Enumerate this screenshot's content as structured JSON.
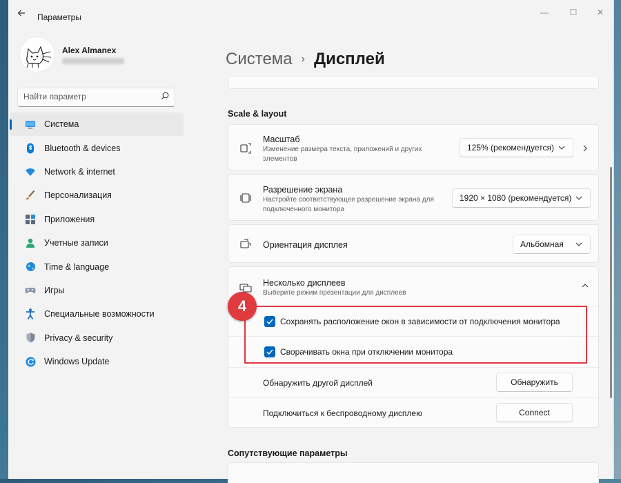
{
  "window": {
    "title": "Параметры",
    "controls": {
      "minimize": "—",
      "maximize": "☐",
      "close": "✕"
    }
  },
  "user": {
    "name": "Alex Almanex"
  },
  "search": {
    "placeholder": "Найти параметр"
  },
  "accent_color": "#0067c0",
  "sidebar": {
    "items": [
      {
        "label": "Система",
        "icon": "display-icon",
        "active": true
      },
      {
        "label": "Bluetooth & devices",
        "icon": "bluetooth-icon"
      },
      {
        "label": "Network & internet",
        "icon": "wifi-icon"
      },
      {
        "label": "Персонализация",
        "icon": "brush-icon"
      },
      {
        "label": "Приложения",
        "icon": "apps-icon"
      },
      {
        "label": "Учетные записи",
        "icon": "person-icon"
      },
      {
        "label": "Time & language",
        "icon": "globe-icon"
      },
      {
        "label": "Игры",
        "icon": "gamepad-icon"
      },
      {
        "label": "Специальные возможности",
        "icon": "accessibility-icon"
      },
      {
        "label": "Privacy & security",
        "icon": "shield-icon"
      },
      {
        "label": "Windows Update",
        "icon": "update-icon"
      }
    ]
  },
  "breadcrumb": {
    "parent": "Система",
    "separator": "›",
    "current": "Дисплей"
  },
  "scale_layout": {
    "heading": "Scale & layout",
    "scale": {
      "title": "Масштаб",
      "description": "Изменение размера текста, приложений и других элементов",
      "value": "125% (рекомендуется)"
    },
    "resolution": {
      "title": "Разрешение экрана",
      "description": "Настройте соответствующее разрешение экрана для подключенного монитора",
      "value": "1920 × 1080 (рекомендуется)"
    },
    "orientation": {
      "title": "Ориентация дисплея",
      "value": "Альбомная"
    },
    "multiple": {
      "title": "Несколько дисплеев",
      "description": "Выберите режим презентации для дисплеев",
      "options": [
        {
          "label": "Сохранять расположение окон в зависимости от подключения монитора",
          "checked": true
        },
        {
          "label": "Сворачивать окна при отключении монитора",
          "checked": true
        }
      ],
      "detect": {
        "label": "Обнаружить другой дисплей",
        "button": "Обнаружить"
      },
      "wireless": {
        "label": "Подключиться к беспроводному дисплею",
        "button": "Connect"
      }
    }
  },
  "related": {
    "heading": "Сопутствующие параметры"
  },
  "annotation": {
    "number": "4",
    "color": "#e0393e"
  }
}
